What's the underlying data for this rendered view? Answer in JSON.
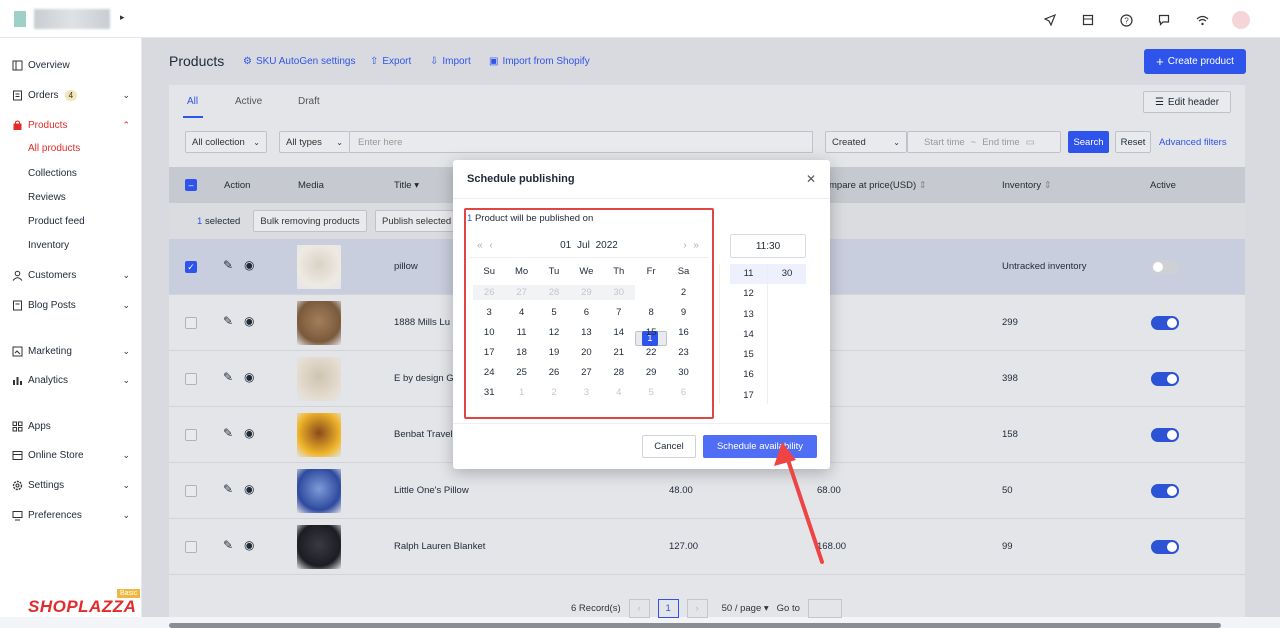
{
  "sidebar": {
    "items": [
      {
        "label": "Overview"
      },
      {
        "label": "Orders",
        "badge": "4"
      },
      {
        "label": "Products"
      },
      {
        "label": "Customers"
      },
      {
        "label": "Blog Posts"
      },
      {
        "label": "Marketing"
      },
      {
        "label": "Analytics"
      },
      {
        "label": "Apps"
      },
      {
        "label": "Online Store"
      },
      {
        "label": "Settings"
      },
      {
        "label": "Preferences"
      }
    ],
    "sub": [
      "All products",
      "Collections",
      "Reviews",
      "Product feed",
      "Inventory"
    ],
    "brand": "SHOPLAZZA",
    "plan": "Basic"
  },
  "header": {
    "title": "Products",
    "links": [
      "SKU AutoGen settings",
      "Export",
      "Import",
      "Import from Shopify"
    ],
    "create": "Create product"
  },
  "tabs": [
    "All",
    "Active",
    "Draft"
  ],
  "edit_header": "Edit header",
  "filters": {
    "collection": "All collection",
    "types": "All types",
    "search_placeholder": "Enter here",
    "sort": "Created",
    "start": "Start time",
    "sep": "~",
    "end": "End time",
    "search_btn": "Search",
    "reset_btn": "Reset",
    "advanced": "Advanced filters"
  },
  "table": {
    "headers": [
      "Action",
      "Media",
      "Title",
      "mpare at price(USD)",
      "Inventory",
      "Active"
    ],
    "selected_count": "1",
    "selected_label": "selected",
    "bulk_remove": "Bulk removing products",
    "publish_selected": "Publish selected",
    "rows": [
      {
        "title": "pillow",
        "price": "",
        "compare": "0",
        "inventory": "Untracked inventory",
        "active": false,
        "checked": true
      },
      {
        "title": "1888 Mills Lu",
        "price": "",
        "compare": ".00",
        "inventory": "299",
        "active": true,
        "checked": false
      },
      {
        "title": "E by design G",
        "price": "",
        "compare": ".00",
        "inventory": "398",
        "active": true,
        "checked": false
      },
      {
        "title": "Benbat Travel",
        "price": "",
        "compare": ".00",
        "inventory": "158",
        "active": true,
        "checked": false
      },
      {
        "title": "Little One's Pillow",
        "price": "48.00",
        "compare": "68.00",
        "inventory": "50",
        "active": true,
        "checked": false
      },
      {
        "title": "Ralph Lauren Blanket",
        "price": "127.00",
        "compare": "168.00",
        "inventory": "99",
        "active": true,
        "checked": false
      }
    ]
  },
  "pager": {
    "records": "6 Record(s)",
    "page": "1",
    "per_page": "50 / page",
    "goto": "Go to"
  },
  "modal": {
    "title": "Schedule publishing",
    "note_count": "1",
    "note_text": "Product will be published on",
    "day": "01",
    "month": "Jul",
    "year": "2022",
    "dow": [
      "Su",
      "Mo",
      "Tu",
      "We",
      "Th",
      "Fr",
      "Sa"
    ],
    "days": [
      "26",
      "27",
      "28",
      "29",
      "30",
      "1",
      "2",
      "3",
      "4",
      "5",
      "6",
      "7",
      "8",
      "9",
      "10",
      "11",
      "12",
      "13",
      "14",
      "15",
      "16",
      "17",
      "18",
      "19",
      "20",
      "21",
      "22",
      "23",
      "24",
      "25",
      "26",
      "27",
      "28",
      "29",
      "30",
      "31",
      "1",
      "2",
      "3",
      "4",
      "5",
      "6"
    ],
    "time": "11:30",
    "hours": [
      "11",
      "12",
      "13",
      "14",
      "15",
      "16",
      "17"
    ],
    "minutes": [
      "30"
    ],
    "cancel": "Cancel",
    "confirm": "Schedule availability"
  }
}
